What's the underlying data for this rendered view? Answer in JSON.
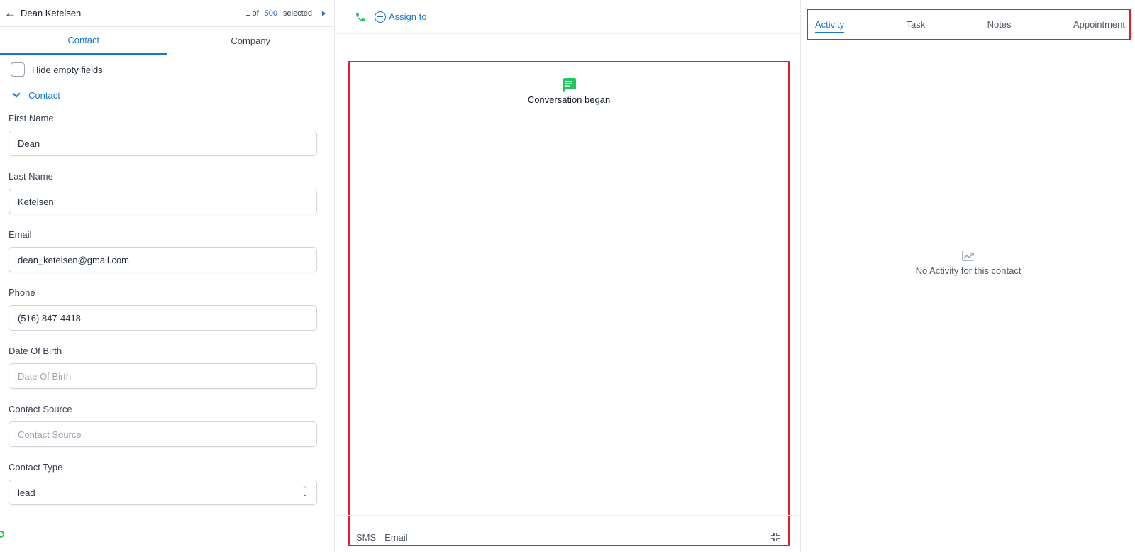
{
  "header": {
    "contact_name": "Dean Ketelsen",
    "pager_prefix": "1 of",
    "pager_total": "500",
    "pager_suffix": "selected"
  },
  "left_tabs": [
    {
      "label": "Contact",
      "active": true
    },
    {
      "label": "Company",
      "active": false
    }
  ],
  "hide_empty_label": "Hide empty fields",
  "section_title": "Contact",
  "fields": {
    "first_name": {
      "label": "First Name",
      "value": "Dean"
    },
    "last_name": {
      "label": "Last Name",
      "value": "Ketelsen"
    },
    "email": {
      "label": "Email",
      "value": "dean_ketelsen@gmail.com"
    },
    "phone": {
      "label": "Phone",
      "value": "(516) 847-4418"
    },
    "dob": {
      "label": "Date Of Birth",
      "placeholder": "Date Of Birth"
    },
    "source": {
      "label": "Contact Source",
      "placeholder": "Contact Source"
    },
    "type": {
      "label": "Contact Type",
      "value": "lead"
    }
  },
  "middle": {
    "assign_label": "Assign to",
    "conversation_began": "Conversation began",
    "compose_tabs": [
      "SMS",
      "Email"
    ]
  },
  "right": {
    "tabs": [
      {
        "label": "Activity",
        "active": true
      },
      {
        "label": "Task",
        "active": false
      },
      {
        "label": "Notes",
        "active": false
      },
      {
        "label": "Appointment",
        "active": false
      }
    ],
    "empty_text": "No Activity for this contact"
  },
  "colors": {
    "accent": "#1976d2",
    "highlight_border": "#e11d2e",
    "phone_green": "#22c55e",
    "chat_green": "#22c55e"
  }
}
